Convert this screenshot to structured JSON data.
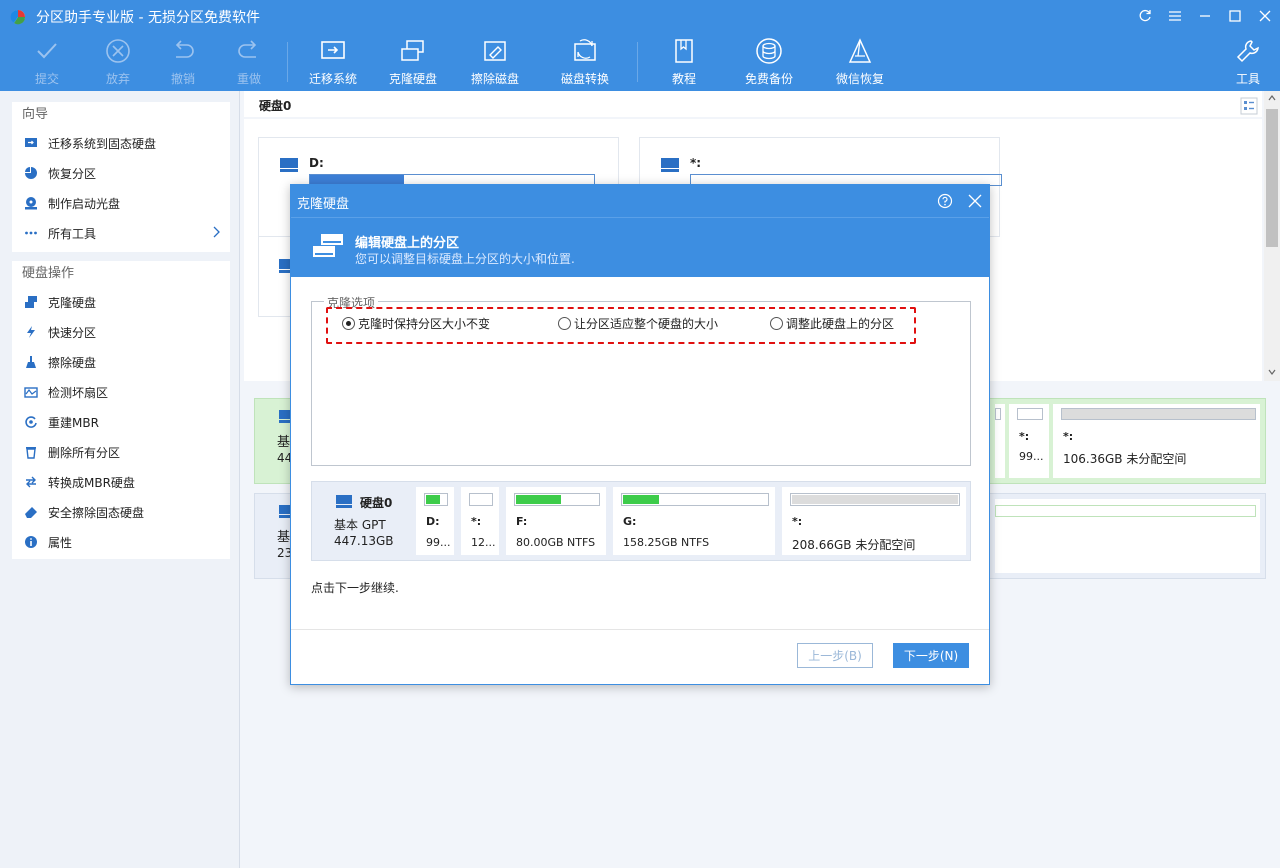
{
  "app": {
    "title": "分区助手专业版 - 无损分区免费软件"
  },
  "toolbar": {
    "commit": "提交",
    "discard": "放弃",
    "undo": "撤销",
    "redo": "重做",
    "migrate": "迁移系统",
    "clone": "克隆硬盘",
    "wipe": "擦除磁盘",
    "convert": "磁盘转换",
    "tutorial": "教程",
    "backup": "免费备份",
    "wechat": "微信恢复",
    "tools": "工具"
  },
  "sidebar": {
    "wizard_title": "向导",
    "wizard_items": [
      {
        "label": "迁移系统到固态硬盘",
        "icon": "migrate-icon"
      },
      {
        "label": "恢复分区",
        "icon": "recover-partition-icon"
      },
      {
        "label": "制作启动光盘",
        "icon": "boot-disc-icon"
      },
      {
        "label": "所有工具",
        "icon": "all-tools-icon"
      }
    ],
    "disk_ops_title": "硬盘操作",
    "disk_ops_items": [
      {
        "label": "克隆硬盘",
        "icon": "clone-disk-icon"
      },
      {
        "label": "快速分区",
        "icon": "lightning-icon"
      },
      {
        "label": "擦除硬盘",
        "icon": "broom-icon"
      },
      {
        "label": "检测坏扇区",
        "icon": "scan-icon"
      },
      {
        "label": "重建MBR",
        "icon": "rebuild-icon"
      },
      {
        "label": "删除所有分区",
        "icon": "trash-icon"
      },
      {
        "label": "转换成MBR硬盘",
        "icon": "convert-icon"
      },
      {
        "label": "安全擦除固态硬盘",
        "icon": "eraser-icon"
      },
      {
        "label": "属性",
        "icon": "info-icon"
      }
    ]
  },
  "main": {
    "disk_header": "硬盘0",
    "upper_cards": [
      {
        "label": "D:"
      },
      {
        "label": "*:"
      }
    ],
    "lower_disks": [
      {
        "type_prefix": "基",
        "size_prefix": "44"
      },
      {
        "type_prefix": "基",
        "size_prefix": "23"
      }
    ],
    "lower_right_parts": [
      {
        "label": "*:",
        "value": "99..."
      },
      {
        "label": "*:",
        "value": "106.36GB 未分配空间"
      }
    ]
  },
  "dialog": {
    "title": "克隆硬盘",
    "banner_heading": "编辑硬盘上的分区",
    "banner_sub": "您可以调整目标硬盘上分区的大小和位置.",
    "options_legend": "克隆选项",
    "options": [
      {
        "label": "克隆时保持分区大小不变",
        "selected": true
      },
      {
        "label": "让分区适应整个硬盘的大小",
        "selected": false
      },
      {
        "label": "调整此硬盘上的分区",
        "selected": false
      }
    ],
    "disk": {
      "name": "硬盘0",
      "type": "基本 GPT",
      "size": "447.13GB",
      "partitions": [
        {
          "label": "D:",
          "value": "99...",
          "used": 0.7
        },
        {
          "label": "*:",
          "value": "12...",
          "used": 0.0
        },
        {
          "label": "F:",
          "value": "80.00GB NTFS",
          "used": 0.55
        },
        {
          "label": "G:",
          "value": "158.25GB NTFS",
          "used": 0.25
        },
        {
          "label": "*:",
          "value": "208.66GB 未分配空间",
          "used": 1.0,
          "unallocated": true
        }
      ]
    },
    "hint": "点击下一步继续.",
    "prev_button": "上一步(B)",
    "next_button": "下一步(N)"
  }
}
